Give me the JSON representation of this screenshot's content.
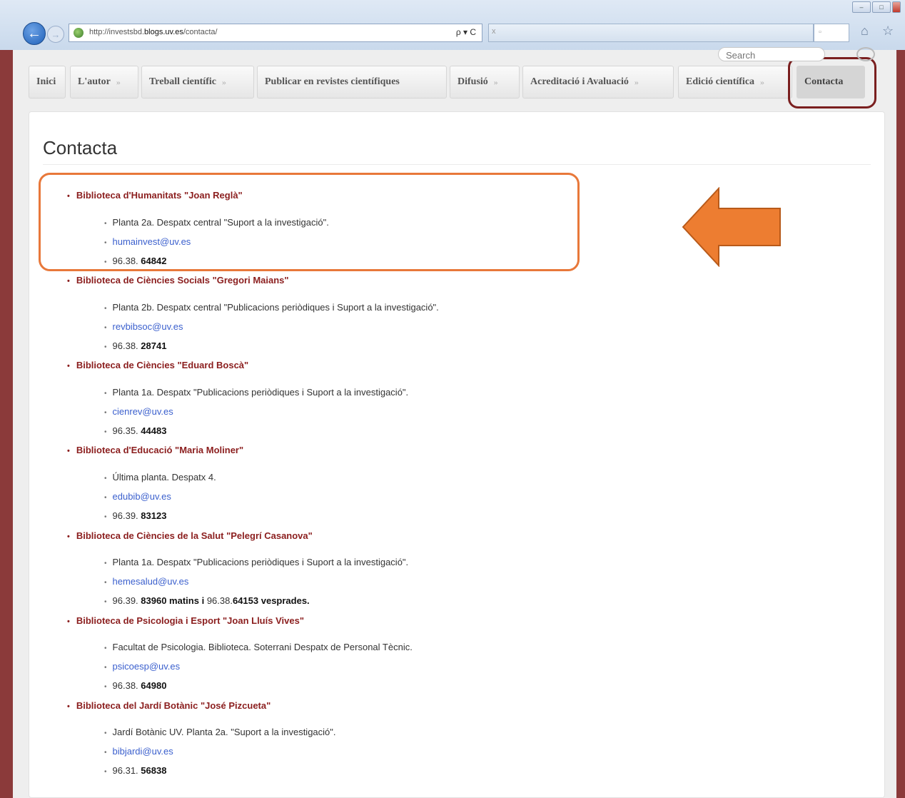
{
  "browser": {
    "url_prefix": "http://investsbd.",
    "url_host": "blogs.uv.es",
    "url_path": "/contacta/",
    "url_controls": "ρ ▾ C",
    "tab_close": "x"
  },
  "search": {
    "placeholder": "Search"
  },
  "menu": {
    "items": [
      {
        "label": "Inici"
      },
      {
        "label": "L'autor"
      },
      {
        "label": "Treball científic"
      },
      {
        "label": "Publicar en revistes científiques"
      },
      {
        "label": "Difusió"
      },
      {
        "label": "Acreditació i Avaluació"
      },
      {
        "label": "Edició científica"
      },
      {
        "label": "Contacta"
      }
    ],
    "active": "Contacta"
  },
  "page": {
    "title": "Contacta",
    "libraries": [
      {
        "name": "Biblioteca d'Humanitats \"Joan Reglà\"",
        "location": "Planta 2a. Despatx central \"Suport a la investigació\".",
        "email": "humainvest@uv.es",
        "phone_prefix": "96.38.",
        "phone": "64842"
      },
      {
        "name": "Biblioteca de Ciències Socials \"Gregori Maians\"",
        "location": "Planta 2b. Despatx central \"Publicacions periòdiques i Suport a la investigació\".",
        "email": "revbibsoc@uv.es",
        "phone_prefix": "96.38.",
        "phone": "28741"
      },
      {
        "name": "Biblioteca de Ciències \"Eduard Boscà\"",
        "location": "Planta 1a. Despatx \"Publicacions periòdiques i Suport a la investigació\".",
        "email": "cienrev@uv.es",
        "phone_prefix": "96.35.",
        "phone": "44483"
      },
      {
        "name": "Biblioteca d'Educació \"Maria Moliner\"",
        "location": "Última planta. Despatx 4.",
        "email": "edubib@uv.es",
        "phone_prefix": "96.39.",
        "phone": "83123"
      },
      {
        "name": "Biblioteca de Ciències de la Salut \"Pelegrí Casanova\"",
        "location": "Planta 1a. Despatx \"Publicacions periòdiques i Suport a la investigació\".",
        "email": "hemesalud@uv.es",
        "phone_prefix": "96.39.",
        "phone": "83960 matins",
        "phone_sep": " i ",
        "phone2_prefix": "96.38.",
        "phone2": "64153 vesprades."
      },
      {
        "name": "Biblioteca de Psicologia i Esport \"Joan Lluís Vives\"",
        "location": "Facultat de Psicologia. Biblioteca. Soterrani Despatx de Personal Tècnic.",
        "email": "psicoesp@uv.es",
        "phone_prefix": "96.38.",
        "phone": "64980"
      },
      {
        "name": "Biblioteca del Jardí Botànic \"José Pizcueta\"",
        "location": "Jardí Botànic UV. Planta 2a. \"Suport a la investigació\".",
        "email": "bibjardi@uv.es",
        "phone_prefix": "96.31.",
        "phone": "56838"
      }
    ]
  },
  "colors": {
    "frame": "#8b3a3a",
    "library_heading": "#8b1e1e",
    "email_link": "#3a5fcd",
    "highlight": "#e8783a",
    "active_ring": "#7a1f1f"
  }
}
